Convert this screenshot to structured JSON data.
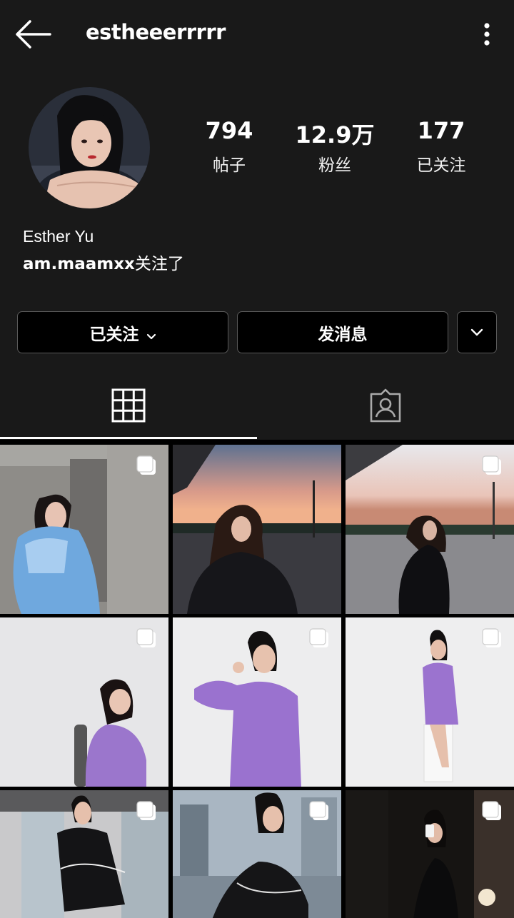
{
  "header": {
    "username": "estheeerrrrr"
  },
  "profile": {
    "stats": [
      {
        "value": "794",
        "label": "帖子"
      },
      {
        "value": "12.9万",
        "label": "粉丝"
      },
      {
        "value": "177",
        "label": "已关注"
      }
    ],
    "full_name": "Esther Yu",
    "followed_by_user": "am.maamxx",
    "followed_by_suffix": "关注了"
  },
  "actions": {
    "following_label": "已关注",
    "message_label": "发消息"
  },
  "tabs": [
    "grid-icon",
    "tagged-icon"
  ],
  "colors": {
    "background": "#191919",
    "button_bg": "#000000",
    "button_border": "#5a5a5a",
    "text": "#ffffff"
  }
}
